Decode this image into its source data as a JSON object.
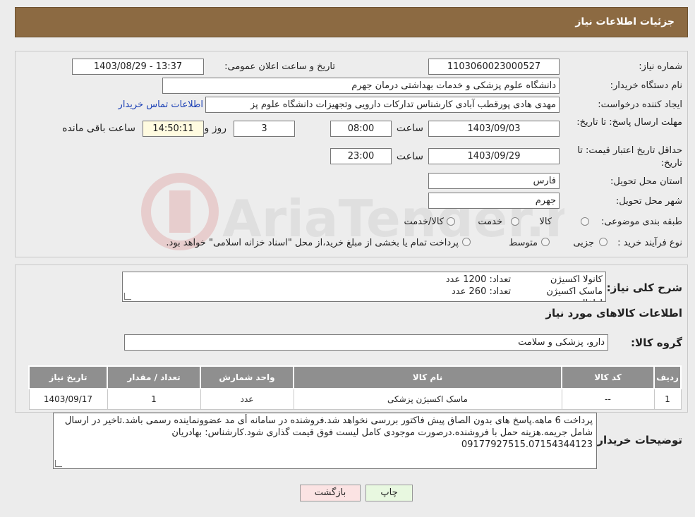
{
  "header": {
    "title": "جزئیات اطلاعات نیاز"
  },
  "watermark": {
    "text": "AriaTender.neT"
  },
  "need": {
    "need_number_label": "شماره نیاز:",
    "need_number": "1103060023000527",
    "announce_label": "تاریخ و ساعت اعلان عمومی:",
    "announce_value": "1403/08/29 - 13:37",
    "buyer_org_label": "نام دستگاه خریدار:",
    "buyer_org": "دانشگاه علوم پزشکی و خدمات بهداشتی  درمان جهرم",
    "creator_label": "ایجاد کننده درخواست:",
    "creator": "مهدی هادی پورقطب آبادی کارشناس تدارکات دارویی وتجهیزات دانشگاه علوم پز",
    "contact_link": "اطلاعات تماس خریدار",
    "reply_deadline_label": "مهلت ارسال پاسخ: تا تاریخ:",
    "reply_date": "1403/09/03",
    "time_label": "ساعت",
    "reply_time": "08:00",
    "days": "3",
    "days_label": "روز و",
    "remaining_time": "14:50:11",
    "remaining_label": "ساعت باقی مانده",
    "price_validity_label": "حداقل تاریخ اعتبار قیمت: تا تاریخ:",
    "price_date": "1403/09/29",
    "price_time": "23:00",
    "province_label": "استان محل تحویل:",
    "province": "فارس",
    "city_label": "شهر محل تحویل:",
    "city": "جهرم",
    "category_label": "طبقه بندی موضوعی:",
    "category_options": [
      "کالا",
      "خدمت",
      "کالا/خدمت"
    ],
    "process_label": "نوع فرآیند خرید :",
    "process_options": [
      "جزیی",
      "متوسط"
    ],
    "process_note": "پرداخت تمام یا بخشی از مبلغ خرید،از محل \"اسناد خزانه اسلامی\" خواهد بود."
  },
  "summary": {
    "label": "شرح کلی نیاز:",
    "line1_item": "کانولا اکسیژن",
    "line1_qty": "تعداد: 1200 عدد",
    "line2_item": "ماسک اکسیژن اطفال",
    "line2_qty": "تعداد: 260 عدد"
  },
  "goods": {
    "section_title": "اطلاعات کالاهای مورد نیاز",
    "group_label": "گروه کالا:",
    "group_value": "دارو، پزشکی و سلامت",
    "columns": [
      "ردیف",
      "کد کالا",
      "نام کالا",
      "واحد شمارش",
      "تعداد / مقدار",
      "تاریخ نیاز"
    ],
    "rows": [
      {
        "idx": "1",
        "code": "--",
        "name": "ماسک اکسیژن پزشکی",
        "unit": "عدد",
        "qty": "1",
        "date": "1403/09/17"
      }
    ]
  },
  "notes": {
    "label": "توضیحات خریدار:",
    "text": "پرداخت 6 ماهه.پاسخ های بدون الصاق پیش فاکتور بررسی نخواهد شد.فروشنده در سامانه أی مد عضوونماینده رسمی باشد.تاخیر در ارسال شامل جریمه.هزینه حمل با فروشنده.درصورت موجودی کامل لیست فوق قیمت گذاری شود.کارشناس: بهادریان 09177927515.07154344123"
  },
  "buttons": {
    "print": "چاپ",
    "back": "بازگشت"
  }
}
